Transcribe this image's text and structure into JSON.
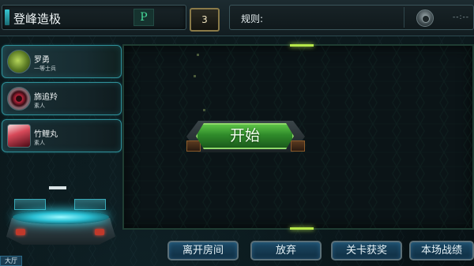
{
  "header": {
    "room_name": "登峰造极",
    "room_icon_label": "P",
    "player_count": "3",
    "rules_label": "规则:",
    "rules_value": "--:--"
  },
  "players": [
    {
      "name": "罗勇",
      "rank": "一等士兵",
      "avatar_icon": "green-monster-avatar"
    },
    {
      "name": "旆追羚",
      "rank": "素人",
      "avatar_icon": "red-eye-avatar"
    },
    {
      "name": "竹鲤丸",
      "rank": "素人",
      "avatar_icon": "red-hair-girl-avatar"
    }
  ],
  "stage": {
    "start_button_label": "开始"
  },
  "footer": {
    "lobby_tab": "大厅",
    "buttons": [
      "离开房间",
      "放弃",
      "关卡获奖",
      "本场战绩"
    ]
  },
  "colors": {
    "accent_cyan": "#2f8f98",
    "start_green": "#5bc246",
    "button_blue": "#1c4a66"
  }
}
